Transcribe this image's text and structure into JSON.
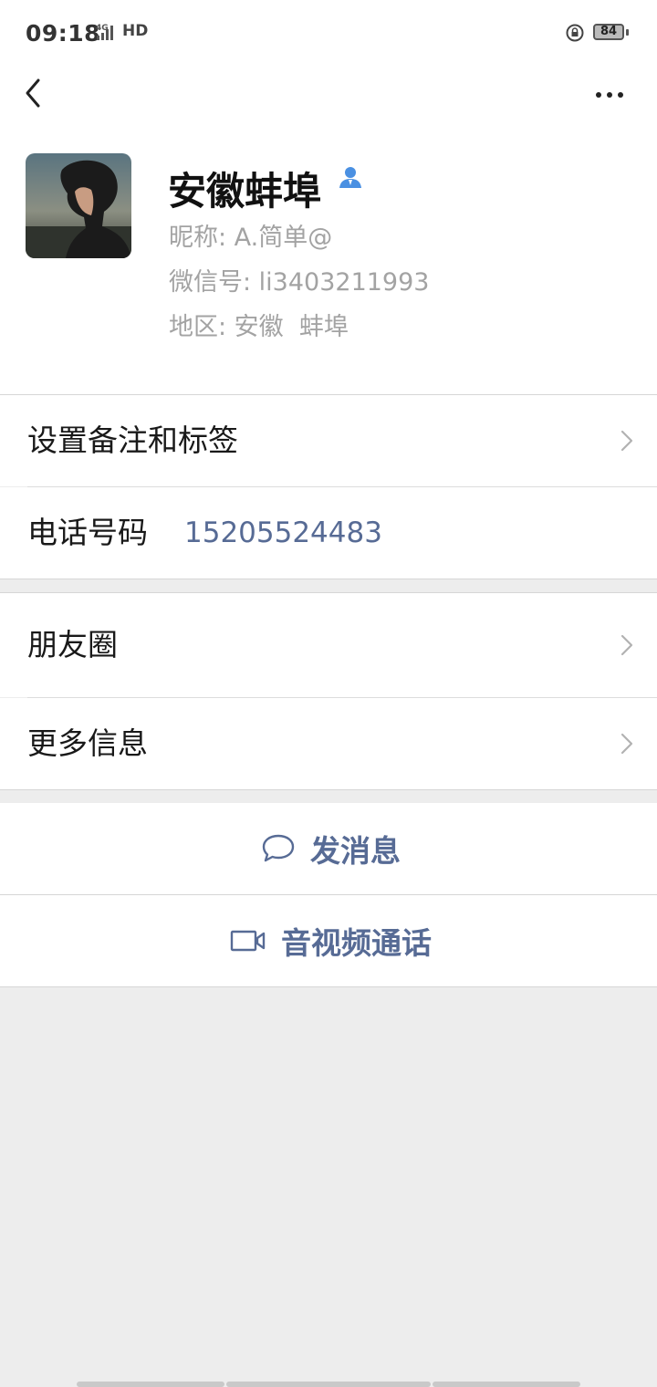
{
  "status_bar": {
    "time": "09:18",
    "network": "4G",
    "hd": "HD",
    "battery": "84"
  },
  "profile": {
    "display_name": "安徽蚌埠",
    "nickname": "昵称: A.简单@",
    "wechat_id": "微信号: li3403211993",
    "region": "地区: 安徽  蚌埠"
  },
  "rows": {
    "remark_tags": "设置备注和标签",
    "phone_label": "电话号码",
    "phone_value": "15205524483",
    "moments": "朋友圈",
    "more_info": "更多信息"
  },
  "actions": {
    "send_message": "发消息",
    "video_call": "音视频通话"
  },
  "colors": {
    "link": "#576b95",
    "background": "#ededed",
    "verified_icon": "#4a90e2"
  },
  "icons": [
    "back-icon",
    "more-icon",
    "contact-person-icon",
    "chevron-right-icon",
    "chat-bubble-icon",
    "video-camera-icon"
  ]
}
